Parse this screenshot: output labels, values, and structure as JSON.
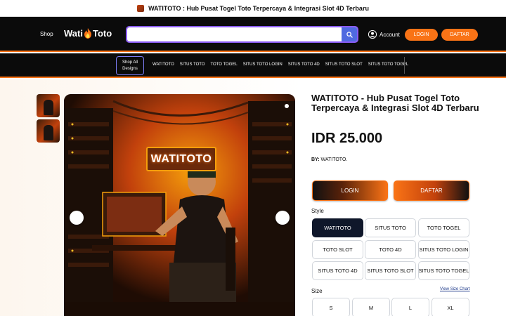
{
  "announcement": {
    "text": "WATITOTO : Hub Pusat Togel Toto Terpercaya & Integrasi Slot 4D Terbaru"
  },
  "header": {
    "shop_label": "Shop",
    "logo_left": "Wati",
    "logo_right": "Toto",
    "search_placeholder": "",
    "account_label": "Account",
    "login_label": "LOGIN",
    "daftar_label": "DAFTAR"
  },
  "nav": {
    "shop_all_line1": "Shop All",
    "shop_all_line2": "Designs",
    "links": [
      "WATITOTO",
      "SITUS TOTO",
      "TOTO TOGEL",
      "SITUS TOTO LOGIN",
      "SITUS TOTO 4D",
      "SITUS TOTO SLOT",
      "SITUS TOTO TOGEL"
    ]
  },
  "hero": {
    "sign_text": "WATITOTO"
  },
  "product": {
    "title": "WATITOTO - Hub Pusat Togel Toto Terpercaya & Integrasi Slot 4D Terbaru",
    "price": "IDR 25.000",
    "by_label": "BY:",
    "by_value": "WATITOTO.",
    "login_button": "LOGIN",
    "daftar_button": "DAFTAR",
    "style_label": "Style",
    "style_options": [
      "WATITOTO",
      "SITUS TOTO",
      "TOTO TOGEL",
      "TOTO SLOT",
      "TOTO 4D",
      "SITUS TOTO LOGIN",
      "SITUS TOTO 4D",
      "SITUS TOTO SLOT",
      "SITUS TOTO TOGEL"
    ],
    "selected_style": "WATITOTO",
    "size_label": "Size",
    "size_chart_link": "View Size Chart",
    "size_options": [
      "S",
      "M",
      "L",
      "XL"
    ]
  },
  "colors": {
    "accent": "#f97316",
    "header_bg": "#0b0b0b",
    "search_border": "#8b5cf6",
    "search_button": "#4f6ae0",
    "selected_option": "#0f172a"
  }
}
